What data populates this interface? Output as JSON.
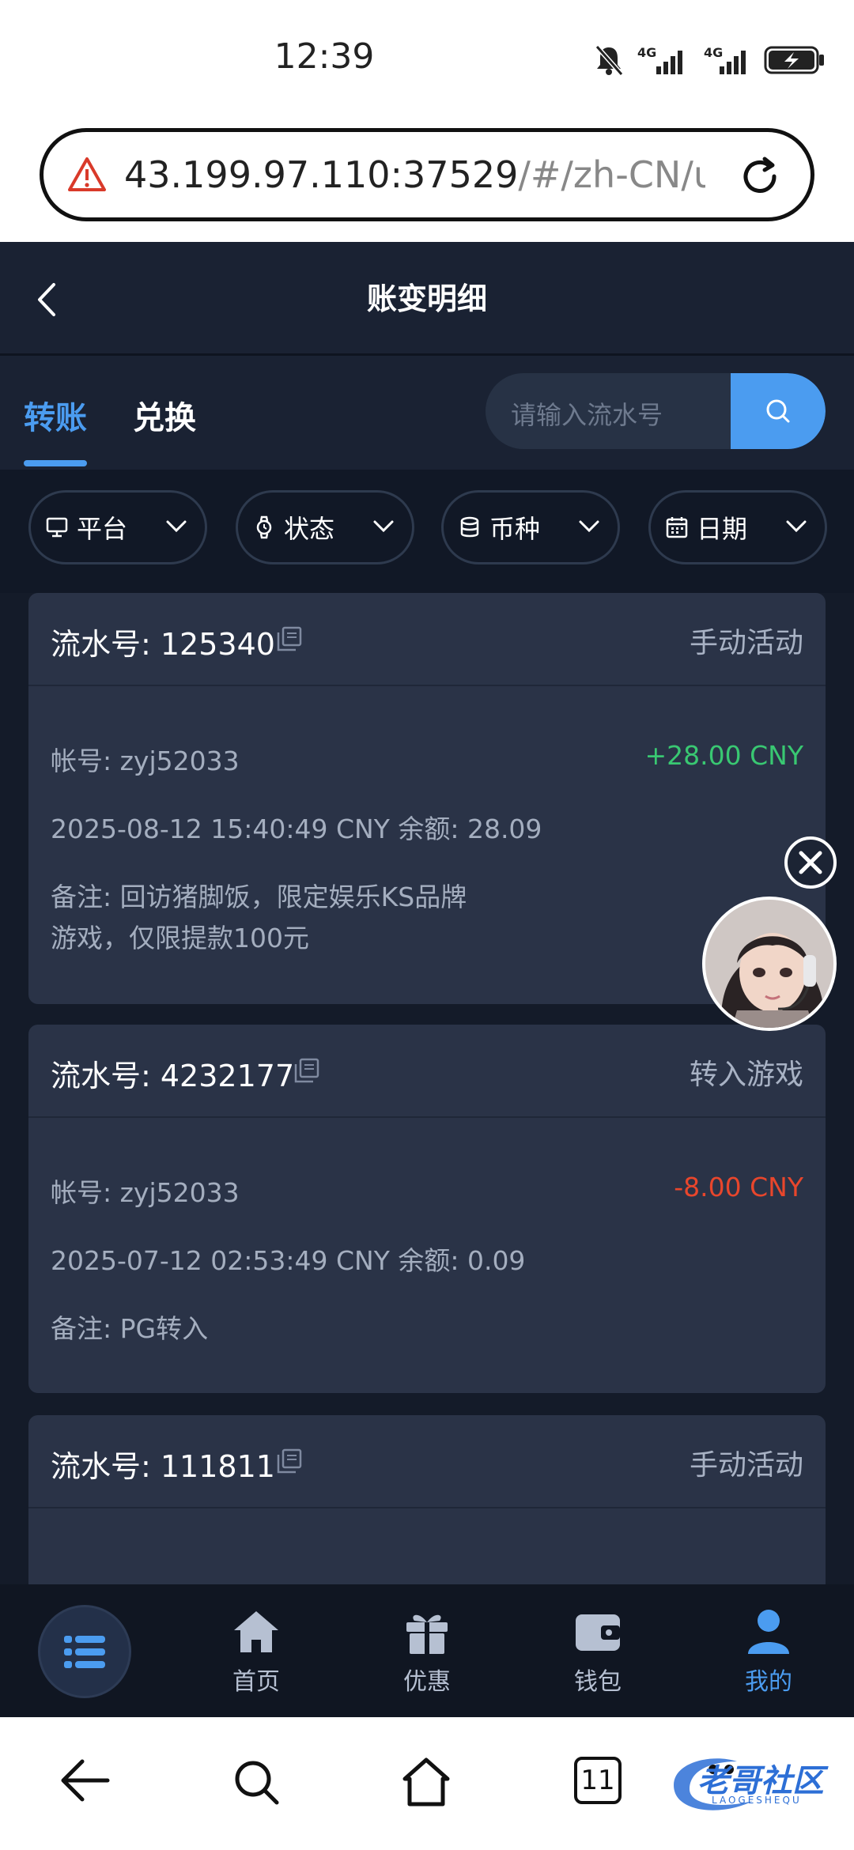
{
  "status_bar": {
    "time": "12:39"
  },
  "browser": {
    "url_main": "43.199.97.110:37529",
    "url_rest": "/#/zh-CN/use"
  },
  "header": {
    "title": "账变明细"
  },
  "tabs": [
    {
      "label": "转账",
      "active": true
    },
    {
      "label": "兑换",
      "active": false
    }
  ],
  "search": {
    "placeholder": "请输入流水号"
  },
  "filters": [
    {
      "label": "平台",
      "icon": "monitor-icon"
    },
    {
      "label": "状态",
      "icon": "watch-icon"
    },
    {
      "label": "币种",
      "icon": "database-icon"
    },
    {
      "label": "日期",
      "icon": "calendar-icon"
    }
  ],
  "records": [
    {
      "serial": "流水号: 125340",
      "type": "手动活动",
      "account": "帐号: zyj52033",
      "amount": "+28.00 CNY",
      "datetime_balance": "2025-08-12 15:40:49 CNY 余额: 28.09",
      "note_line1": "备注: 回访猪脚饭，限定娱乐KS品牌",
      "note_line2": "游戏，仅限提款100元"
    },
    {
      "serial": "流水号: 4232177",
      "type": "转入游戏",
      "account": "帐号: zyj52033",
      "amount": "-8.00 CNY",
      "datetime_balance": "2025-07-12 02:53:49 CNY 余额: 0.09",
      "note_line1": "备注: PG转入"
    },
    {
      "serial": "流水号: 111811",
      "type": "手动活动"
    }
  ],
  "bottom_nav": {
    "items": [
      {
        "label": "首页",
        "icon": "home-icon"
      },
      {
        "label": "优惠",
        "icon": "gift-icon"
      },
      {
        "label": "钱包",
        "icon": "wallet-icon"
      },
      {
        "label": "我的",
        "icon": "user-icon",
        "active": true
      }
    ]
  },
  "system_bar": {
    "tab_count": "11"
  },
  "watermark": {
    "text": "老哥社区",
    "sub": "LAOGESHEQU"
  },
  "colors": {
    "accent": "#4b9cf0",
    "positive": "#39c872",
    "negative": "#e8462c",
    "card": "#2a3347",
    "background": "#141b29"
  }
}
